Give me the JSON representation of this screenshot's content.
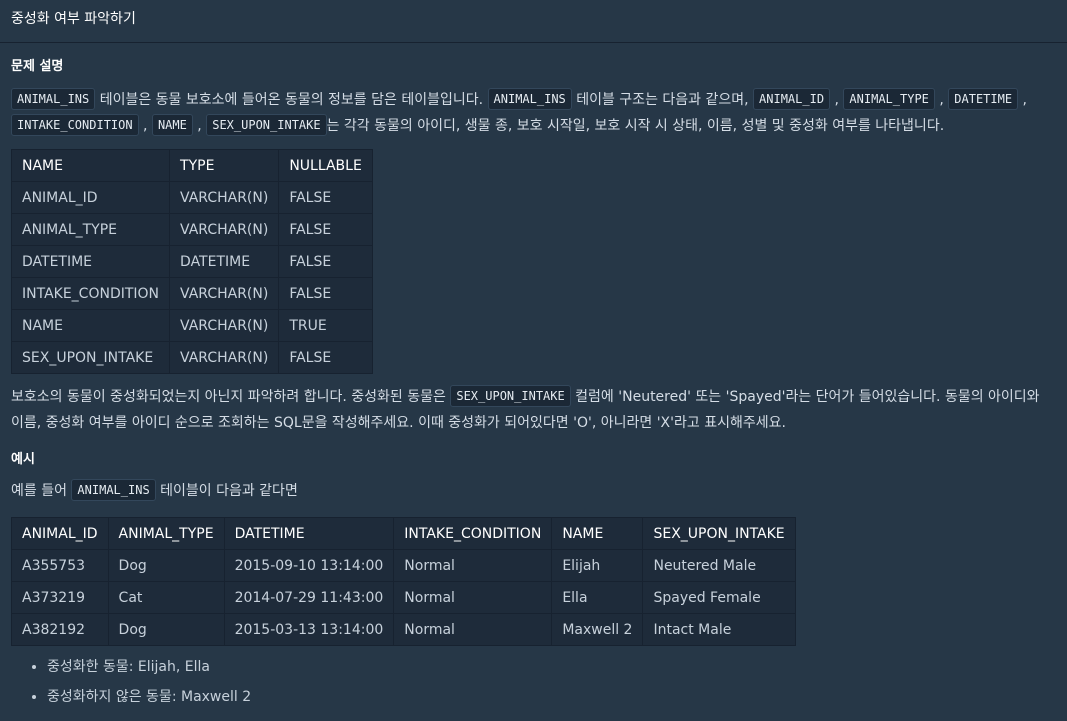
{
  "header": {
    "title": "중성화 여부 파악하기"
  },
  "section1": {
    "title": "문제 설명",
    "intro": [
      {
        "code": "ANIMAL_INS"
      },
      {
        "text": " 테이블은 동물 보호소에 들어온 동물의 정보를 담은 테이블입니다. "
      },
      {
        "code": "ANIMAL_INS"
      },
      {
        "text": " 테이블 구조는 다음과 같으며, "
      },
      {
        "code": "ANIMAL_ID"
      },
      {
        "text": " , "
      },
      {
        "code": "ANIMAL_TYPE"
      },
      {
        "text": " , "
      },
      {
        "code": "DATETIME"
      },
      {
        "text": " , "
      },
      {
        "code": "INTAKE_CONDITION"
      },
      {
        "text": " , "
      },
      {
        "code": "NAME"
      },
      {
        "text": " , "
      },
      {
        "code": "SEX_UPON_INTAKE"
      },
      {
        "text": "는 각각 동물의 아이디, 생물 종, 보호 시작일, 보호 시작 시 상태, 이름, 성별 및 중성화 여부를 나타냅니다."
      }
    ],
    "schema_table": {
      "headers": [
        "NAME",
        "TYPE",
        "NULLABLE"
      ],
      "rows": [
        [
          "ANIMAL_ID",
          "VARCHAR(N)",
          "FALSE"
        ],
        [
          "ANIMAL_TYPE",
          "VARCHAR(N)",
          "FALSE"
        ],
        [
          "DATETIME",
          "DATETIME",
          "FALSE"
        ],
        [
          "INTAKE_CONDITION",
          "VARCHAR(N)",
          "FALSE"
        ],
        [
          "NAME",
          "VARCHAR(N)",
          "TRUE"
        ],
        [
          "SEX_UPON_INTAKE",
          "VARCHAR(N)",
          "FALSE"
        ]
      ]
    },
    "task": [
      {
        "text": "보호소의 동물이 중성화되었는지 아닌지 파악하려 합니다. 중성화된 동물은 "
      },
      {
        "code": "SEX_UPON_INTAKE"
      },
      {
        "text": " 컬럼에 'Neutered' 또는 'Spayed'라는 단어가 들어있습니다. 동물의 아이디와 이름, 중성화 여부를 아이디 순으로 조회하는 SQL문을 작성해주세요. 이때 중성화가 되어있다면 'O', 아니라면 'X'라고 표시해주세요."
      }
    ]
  },
  "section2": {
    "title": "예시",
    "intro": [
      {
        "text": "예를 들어 "
      },
      {
        "code": "ANIMAL_INS"
      },
      {
        "text": " 테이블이 다음과 같다면"
      }
    ],
    "example_table": {
      "headers": [
        "ANIMAL_ID",
        "ANIMAL_TYPE",
        "DATETIME",
        "INTAKE_CONDITION",
        "NAME",
        "SEX_UPON_INTAKE"
      ],
      "rows": [
        [
          "A355753",
          "Dog",
          "2015-09-10 13:14:00",
          "Normal",
          "Elijah",
          "Neutered Male"
        ],
        [
          "A373219",
          "Cat",
          "2014-07-29 11:43:00",
          "Normal",
          "Ella",
          "Spayed Female"
        ],
        [
          "A382192",
          "Dog",
          "2015-03-13 13:14:00",
          "Normal",
          "Maxwell 2",
          "Intact Male"
        ]
      ]
    },
    "bullets": [
      "중성화한 동물: Elijah, Ella",
      "중성화하지 않은 동물: Maxwell 2"
    ]
  }
}
